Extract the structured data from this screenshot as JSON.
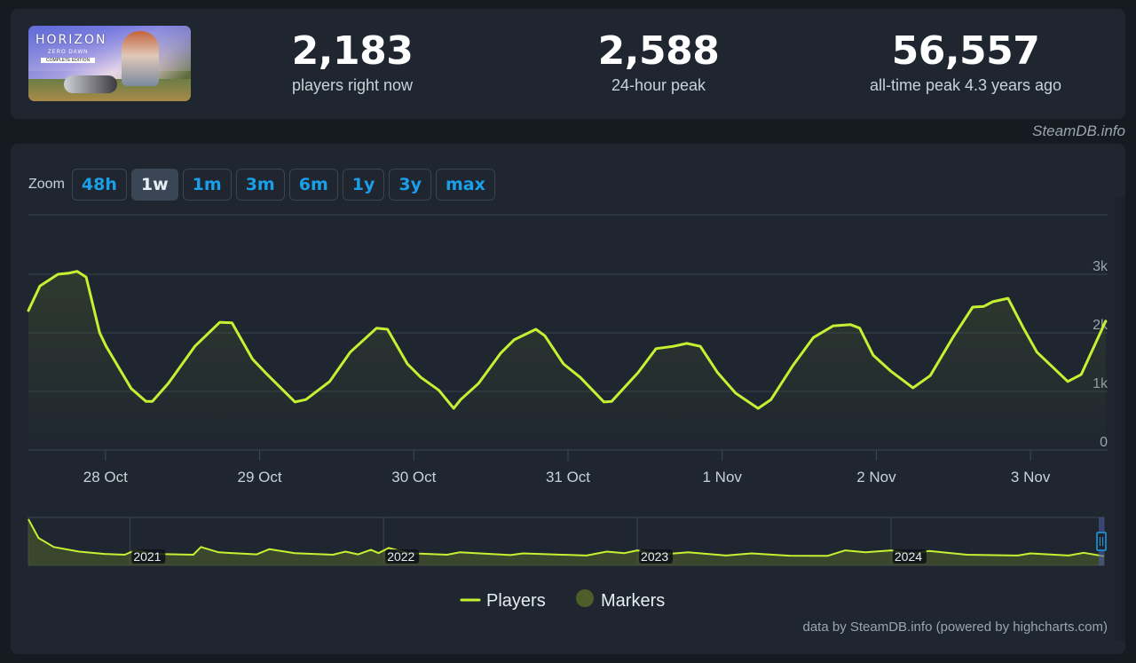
{
  "game": {
    "thumbnail_alt": "Horizon Zero Dawn Complete Edition",
    "logo_text": "HORIZON",
    "logo_sub": "ZERO DAWN",
    "logo_edition": "COMPLETE EDITION"
  },
  "stats": {
    "current": {
      "value": "2,183",
      "label": "players right now"
    },
    "peak_24h": {
      "value": "2,588",
      "label": "24-hour peak"
    },
    "all_time": {
      "value": "56,557",
      "label": "all-time peak 4.3 years ago"
    }
  },
  "credit_top": "SteamDB.info",
  "zoom": {
    "label": "Zoom",
    "options": [
      "48h",
      "1w",
      "1m",
      "3m",
      "6m",
      "1y",
      "3y",
      "max"
    ],
    "active": "1w"
  },
  "credit_bottom": "data by SteamDB.info (powered by highcharts.com)",
  "colors": {
    "line": "#c6f032",
    "marker": "#4d5e2b",
    "accent": "#1a9fe8"
  },
  "chart_data": {
    "type": "line",
    "title": "",
    "xlabel": "",
    "ylabel": "",
    "x_unit": "hours since 27 Oct 12:00",
    "x_range": [
      0,
      168
    ],
    "ylim": [
      0,
      3300
    ],
    "y_ticks": [
      0,
      1000,
      2000,
      3000
    ],
    "y_tick_labels": [
      "0",
      "1k",
      "2k",
      "3k"
    ],
    "x_ticks": [
      12,
      36,
      60,
      84,
      108,
      132,
      156
    ],
    "x_tick_labels": [
      "28 Oct",
      "29 Oct",
      "30 Oct",
      "31 Oct",
      "1 Nov",
      "2 Nov",
      "3 Nov"
    ],
    "grid": true,
    "legend": {
      "position": "bottom-center",
      "entries": [
        "Players",
        "Markers"
      ]
    },
    "series": [
      {
        "name": "Players",
        "x": [
          0,
          1.8,
          4.6,
          6.3,
          7.6,
          9.0,
          11.1,
          12.1,
          16.0,
          18.3,
          19.3,
          21.8,
          25.9,
          29.8,
          31.7,
          34.9,
          36.9,
          41.5,
          43.2,
          46.9,
          50.1,
          54.2,
          55.9,
          59.0,
          61.1,
          63.9,
          66.2,
          67.3,
          70.1,
          73.5,
          75.6,
          79.0,
          80.4,
          83.3,
          85.9,
          89.6,
          90.8,
          94.9,
          97.7,
          100.4,
          102.5,
          104.6,
          107.3,
          110.1,
          113.6,
          115.6,
          119.0,
          122.2,
          125.3,
          128.0,
          129.4,
          131.5,
          134.2,
          137.7,
          140.4,
          143.9,
          147.0,
          148.7,
          150.1,
          152.5,
          154.9,
          157.0,
          159.7,
          161.8,
          163.9,
          167.7
        ],
        "values": [
          2380,
          2800,
          3000,
          3020,
          3050,
          2950,
          2000,
          1770,
          1050,
          830,
          830,
          1140,
          1770,
          2180,
          2170,
          1550,
          1320,
          820,
          860,
          1170,
          1670,
          2080,
          2060,
          1470,
          1240,
          1020,
          710,
          860,
          1140,
          1650,
          1880,
          2060,
          1950,
          1470,
          1240,
          820,
          830,
          1320,
          1730,
          1770,
          1820,
          1770,
          1320,
          970,
          710,
          860,
          1440,
          1920,
          2120,
          2140,
          2080,
          1620,
          1350,
          1060,
          1270,
          1920,
          2440,
          2450,
          2530,
          2590,
          2080,
          1670,
          1390,
          1170,
          1290,
          2200
        ]
      }
    ],
    "navigator": {
      "x_tick_labels": [
        "2021",
        "2022",
        "2023",
        "2024"
      ],
      "x_unit": "years",
      "x_range": [
        2020.6,
        2024.84
      ],
      "x_ticks": [
        2021,
        2022,
        2023,
        2024
      ],
      "approx_values": [
        [
          2020.6,
          56557
        ],
        [
          2020.64,
          20000
        ],
        [
          2020.7,
          9000
        ],
        [
          2020.8,
          5000
        ],
        [
          2020.9,
          3500
        ],
        [
          2020.98,
          3000
        ],
        [
          2021.02,
          6000
        ],
        [
          2021.1,
          3500
        ],
        [
          2021.25,
          3000
        ],
        [
          2021.28,
          9000
        ],
        [
          2021.35,
          4500
        ],
        [
          2021.5,
          3200
        ],
        [
          2021.55,
          7000
        ],
        [
          2021.65,
          4000
        ],
        [
          2021.8,
          3000
        ],
        [
          2021.85,
          5000
        ],
        [
          2021.9,
          3200
        ],
        [
          2021.95,
          6500
        ],
        [
          2021.98,
          4000
        ],
        [
          2022.02,
          8000
        ],
        [
          2022.1,
          4000
        ],
        [
          2022.25,
          3000
        ],
        [
          2022.3,
          4500
        ],
        [
          2022.5,
          2800
        ],
        [
          2022.55,
          3800
        ],
        [
          2022.8,
          2600
        ],
        [
          2022.88,
          5000
        ],
        [
          2022.95,
          4000
        ],
        [
          2023.0,
          6000
        ],
        [
          2023.08,
          3000
        ],
        [
          2023.2,
          4500
        ],
        [
          2023.35,
          2600
        ],
        [
          2023.45,
          3800
        ],
        [
          2023.6,
          2500
        ],
        [
          2023.75,
          2400
        ],
        [
          2023.82,
          6000
        ],
        [
          2023.9,
          4500
        ],
        [
          2024.0,
          6000
        ],
        [
          2024.08,
          3500
        ],
        [
          2024.15,
          5500
        ],
        [
          2024.3,
          3000
        ],
        [
          2024.5,
          2600
        ],
        [
          2024.55,
          3800
        ],
        [
          2024.7,
          2600
        ],
        [
          2024.76,
          4200
        ],
        [
          2024.84,
          2200
        ]
      ]
    }
  }
}
